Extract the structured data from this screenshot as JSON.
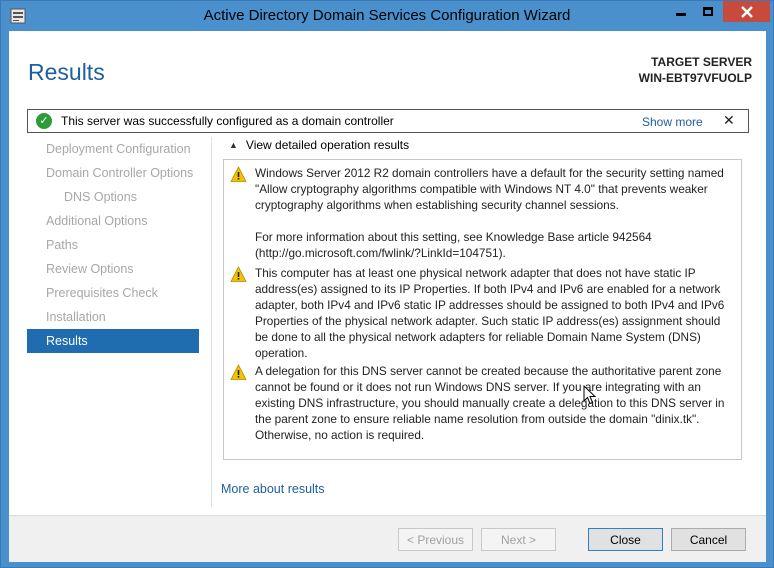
{
  "window": {
    "title": "Active Directory Domain Services Configuration Wizard"
  },
  "header": {
    "page_title": "Results",
    "target_label": "TARGET SERVER",
    "target_name": "WIN-EBT97VFUOLP"
  },
  "banner": {
    "message": "This server was successfully configured as a domain controller",
    "show_more": "Show more",
    "close_glyph": "✕"
  },
  "sidebar": {
    "items": [
      {
        "label": "Deployment Configuration",
        "state": "disabled"
      },
      {
        "label": "Domain Controller Options",
        "state": "disabled"
      },
      {
        "label": "DNS Options",
        "state": "disabled"
      },
      {
        "label": "Additional Options",
        "state": "disabled"
      },
      {
        "label": "Paths",
        "state": "disabled"
      },
      {
        "label": "Review Options",
        "state": "disabled"
      },
      {
        "label": "Prerequisites Check",
        "state": "disabled"
      },
      {
        "label": "Installation",
        "state": "disabled"
      },
      {
        "label": "Results",
        "state": "active"
      }
    ]
  },
  "details": {
    "toggle_label": "View detailed operation results",
    "messages": [
      {
        "icon": "warning-icon",
        "paragraphs": [
          "Windows Server 2012 R2 domain controllers have a default for the security setting named \"Allow cryptography algorithms compatible with Windows NT 4.0\" that prevents weaker cryptography algorithms when establishing security channel sessions.",
          "For more information about this setting, see Knowledge Base article 942564 (http://go.microsoft.com/fwlink/?LinkId=104751)."
        ]
      },
      {
        "icon": "warning-icon",
        "paragraphs": [
          "This computer has at least one physical network adapter that does not have static IP address(es) assigned to its IP Properties. If both IPv4 and IPv6 are enabled for a network adapter, both IPv4 and IPv6 static IP addresses should be assigned to both IPv4 and IPv6 Properties of the physical network adapter. Such static IP address(es) assignment should be done to all the physical network adapters for reliable Domain Name System (DNS) operation."
        ]
      },
      {
        "icon": "warning-icon",
        "paragraphs": [
          "A delegation for this DNS server cannot be created because the authoritative parent zone cannot be found or it does not run Windows DNS server. If you are integrating with an existing DNS infrastructure, you should manually create a delegation to this DNS server in the parent zone to ensure reliable name resolution from outside the domain \"dinix.tk\". Otherwise, no action is required."
        ]
      }
    ]
  },
  "links": {
    "more_about_results": "More about results"
  },
  "footer": {
    "previous": "< Previous",
    "next": "Next >",
    "close": "Close",
    "cancel": "Cancel"
  },
  "colors": {
    "accent": "#1f6cb0",
    "title_bar": "#4a90cd",
    "close_button": "#c74a3d",
    "success": "#2e9c3a",
    "warning": "#f2c200",
    "link": "#1e5fa0"
  }
}
